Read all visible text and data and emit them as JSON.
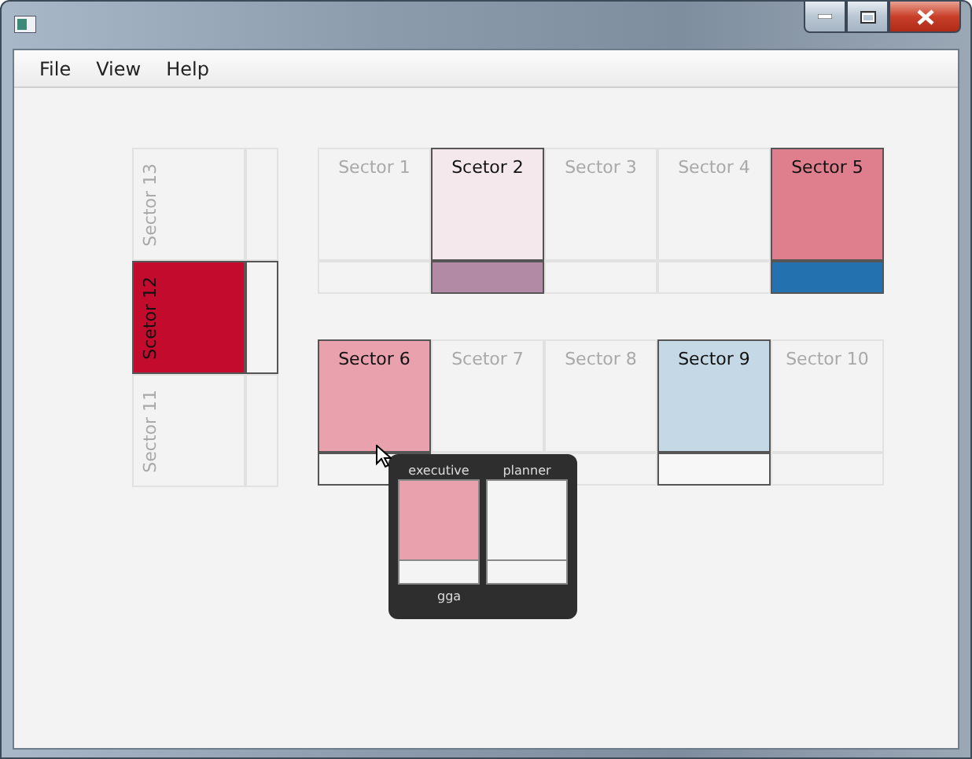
{
  "menu": [
    {
      "label": "File"
    },
    {
      "label": "View"
    },
    {
      "label": "Help"
    }
  ],
  "left_column": [
    {
      "label": "Sector 13",
      "active": false
    },
    {
      "label": "Scetor 12",
      "active": true,
      "color": "#c20b2d",
      "strip": {
        "color": "#f4f4f4"
      }
    },
    {
      "label": "Sector 11",
      "active": false
    }
  ],
  "rows": [
    [
      {
        "label": "Sector 1",
        "active": false
      },
      {
        "label": "Scetor 2",
        "active": true,
        "color": "#f4e8ec",
        "strip": {
          "color": "#b28aa5"
        }
      },
      {
        "label": "Sector 3",
        "active": false
      },
      {
        "label": "Sector 4",
        "active": false
      },
      {
        "label": "Sector 5",
        "active": true,
        "color": "#df7f8e",
        "strip": {
          "color": "#2471b0"
        }
      }
    ],
    [
      {
        "label": "Sector 6",
        "active": true,
        "color": "#e8a1ad",
        "strip": {
          "color": "#f4f4f4"
        }
      },
      {
        "label": "Scetor 7",
        "active": false
      },
      {
        "label": "Sector 8",
        "active": false
      },
      {
        "label": "Sector 9",
        "active": true,
        "color": "#c4d8e6",
        "strip": {
          "color": "#f7f7f7"
        }
      },
      {
        "label": "Sector 10",
        "active": false
      }
    ]
  ],
  "tooltip": {
    "columns": [
      {
        "label": "executive",
        "color": "#e8a1ad",
        "strip": {
          "color": "#f4f4f4"
        }
      },
      {
        "label": "planner",
        "color": "#f4f4f4",
        "strip": {
          "color": "#f4f4f4"
        }
      }
    ],
    "footer": "gga"
  }
}
